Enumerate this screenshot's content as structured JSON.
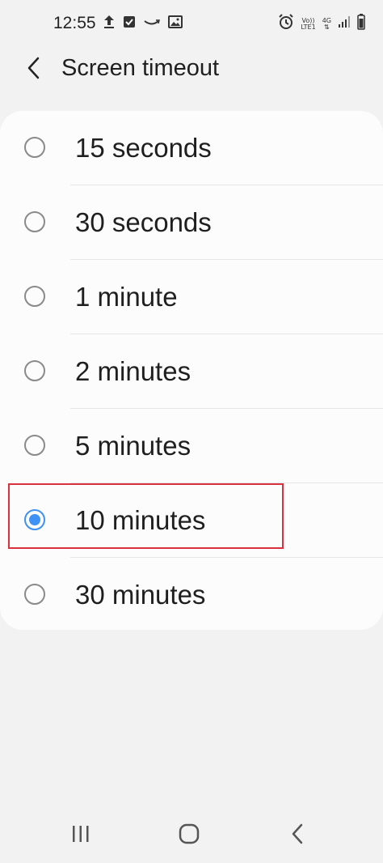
{
  "status_bar": {
    "time": "12:55",
    "left_icons": [
      "upload-icon",
      "checkbox-icon",
      "amazon-smile-icon",
      "gallery-icon"
    ],
    "right_icons": [
      "alarm-icon",
      "volte-icon",
      "4g-data-icon",
      "signal-icon",
      "battery-icon"
    ],
    "volte_line1": "Vo))",
    "volte_line2": "LTE1",
    "network_type": "4G"
  },
  "header": {
    "back_icon": "chevron-left-icon",
    "title": "Screen timeout"
  },
  "options": [
    {
      "label": "15 seconds",
      "selected": false
    },
    {
      "label": "30 seconds",
      "selected": false
    },
    {
      "label": "1 minute",
      "selected": false
    },
    {
      "label": "2 minutes",
      "selected": false
    },
    {
      "label": "5 minutes",
      "selected": false
    },
    {
      "label": "10 minutes",
      "selected": true
    },
    {
      "label": "30 minutes",
      "selected": false
    }
  ],
  "colors": {
    "accent": "#3e91f5",
    "highlight": "#d9313d",
    "background": "#f2f2f2",
    "card": "#fcfcfc"
  },
  "nav_bar": {
    "icons": [
      "recent-apps-icon",
      "home-icon",
      "back-icon"
    ]
  }
}
